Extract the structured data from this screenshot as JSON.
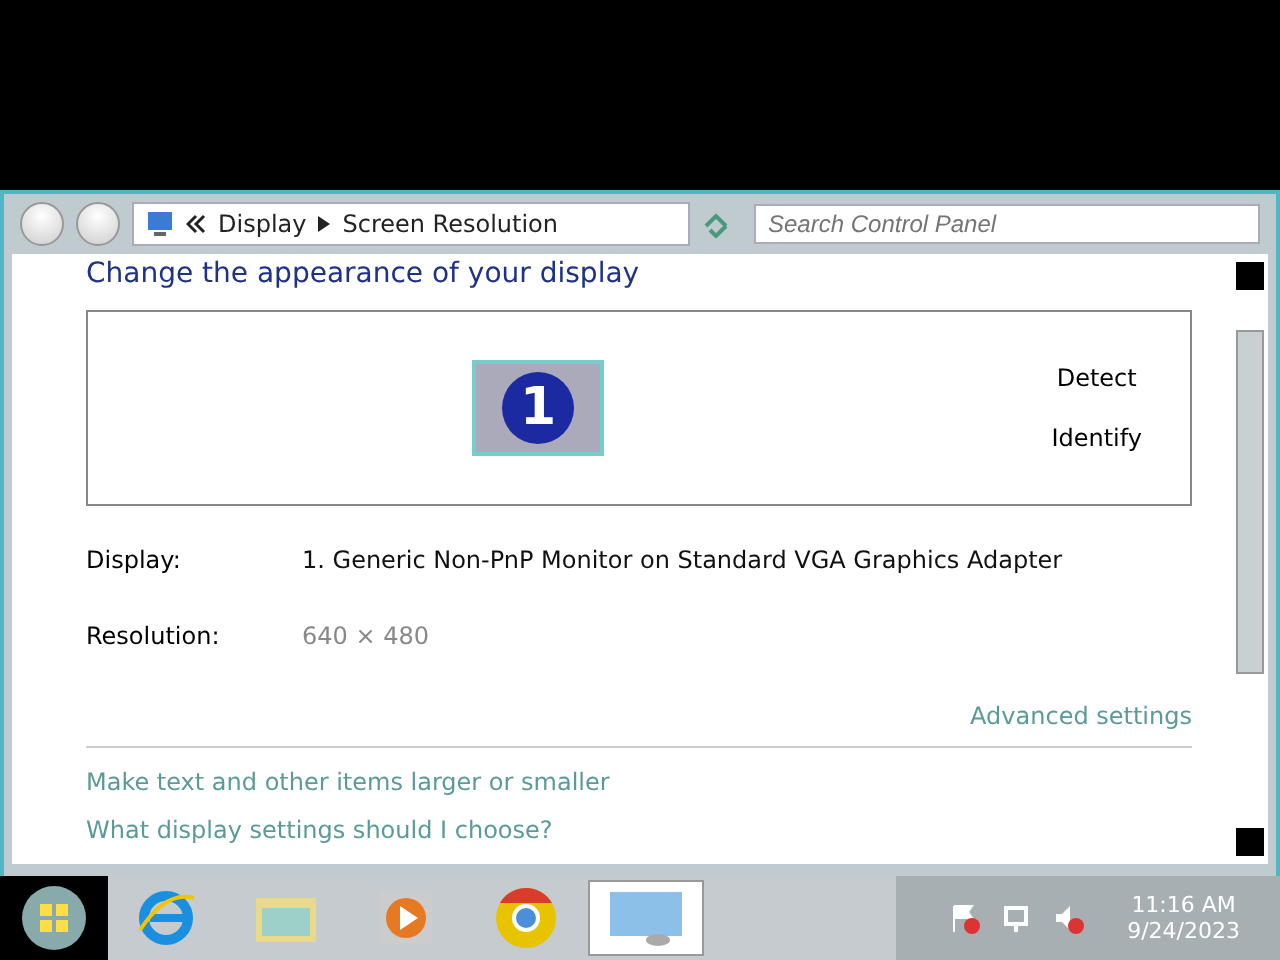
{
  "address_bar": {
    "crumbs": [
      "Display",
      "Screen Resolution"
    ]
  },
  "search": {
    "placeholder": "Search Control Panel"
  },
  "heading": "Change the appearance of your display",
  "monitor_area": {
    "monitor_number": "1",
    "buttons": [
      "Detect",
      "Identify"
    ]
  },
  "fields": [
    {
      "label": "Display:",
      "value": "1. Generic Non-PnP Monitor on Standard VGA Graphics Adapter",
      "disabled": false
    },
    {
      "label": "Resolution:",
      "value": "640 × 480",
      "disabled": true
    }
  ],
  "advanced_link": "Advanced settings",
  "links": [
    "Make text and other items larger or smaller",
    "What display settings should I choose?"
  ],
  "taskbar": {
    "apps": [
      {
        "kind": "ie",
        "selected": false
      },
      {
        "kind": "explorer",
        "selected": false
      },
      {
        "kind": "media",
        "selected": false
      },
      {
        "kind": "chrome",
        "selected": false
      },
      {
        "kind": "control",
        "selected": true
      }
    ],
    "time": "11:16 AM",
    "date": "9/24/2023"
  }
}
